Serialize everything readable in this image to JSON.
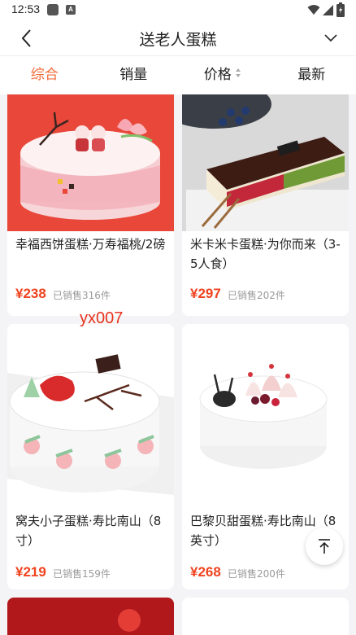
{
  "status_bar": {
    "time": "12:53",
    "notification_badge": "A"
  },
  "header": {
    "title": "送老人蛋糕",
    "back_icon": "chevron-left-icon",
    "more_icon": "chevron-down-icon"
  },
  "tabs": [
    {
      "label": "综合",
      "active": true
    },
    {
      "label": "销量",
      "active": false
    },
    {
      "label": "价格",
      "active": false,
      "icon": "sort-icon"
    },
    {
      "label": "最新",
      "active": false
    }
  ],
  "products": [
    {
      "name": "幸福西饼蛋糕·万寿福桃/2磅",
      "price": "¥238",
      "sold": "已销售316件"
    },
    {
      "name": "米卡米卡蛋糕·为你而来（3-5人食）",
      "price": "¥297",
      "sold": "已销售202件"
    },
    {
      "name": "窝夫小子蛋糕·寿比南山（8寸）",
      "price": "¥219",
      "sold": "已销售159件"
    },
    {
      "name": "巴黎贝甜蛋糕·寿比南山（8英寸）",
      "price": "¥268",
      "sold": "已销售200件"
    }
  ],
  "watermark": "yx007",
  "colors": {
    "accent": "#f26b3a",
    "price": "#f0431f",
    "watermark": "#e8331d"
  },
  "back_to_top_icon": "arrow-up-to-top-icon"
}
